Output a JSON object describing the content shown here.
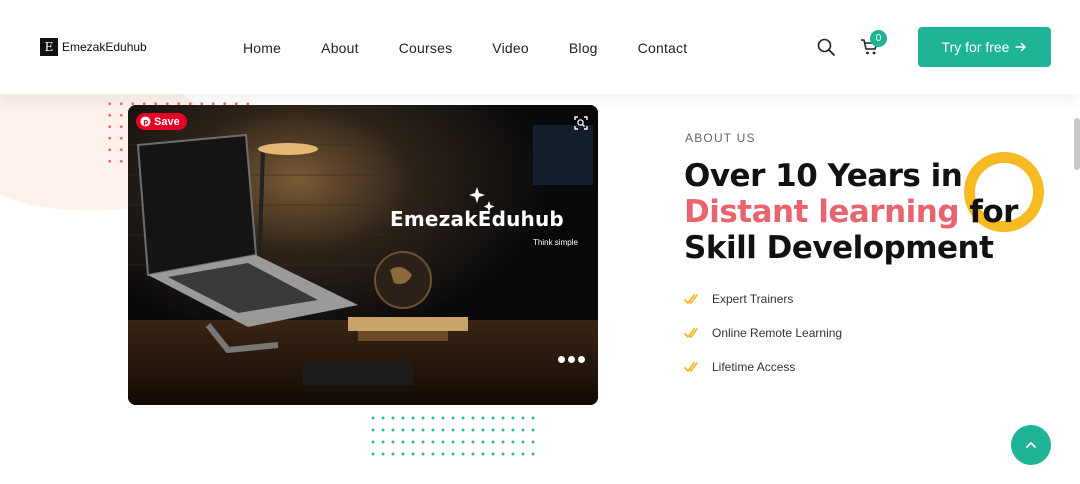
{
  "brand": {
    "logo_letter": "E",
    "name": "EmezakEduhub"
  },
  "nav": {
    "items": [
      "Home",
      "About",
      "Courses",
      "Video",
      "Blog",
      "Contact"
    ]
  },
  "header": {
    "cart_count": "0",
    "cta_label": "Try for free"
  },
  "media": {
    "save_label": "Save",
    "brand_title": "EmezakEduhub",
    "tagline": "Think simple"
  },
  "about": {
    "label": "ABOUT US",
    "heading_line1": "Over 10 Years in",
    "heading_accent": "Distant learning",
    "heading_line2_end": " for",
    "heading_line3": "Skill Development",
    "features": [
      "Expert Trainers",
      "Online Remote Learning",
      "Lifetime Access"
    ]
  },
  "colors": {
    "accent": "#20b497",
    "highlight": "#e8646e",
    "ring": "#f7b924",
    "check": "#f7b924",
    "pin": "#e60023"
  },
  "icons": {
    "search": "search-icon",
    "cart": "cart-icon",
    "arrow": "arrow-right-icon",
    "check": "check-icon",
    "up": "chevron-up-icon"
  }
}
